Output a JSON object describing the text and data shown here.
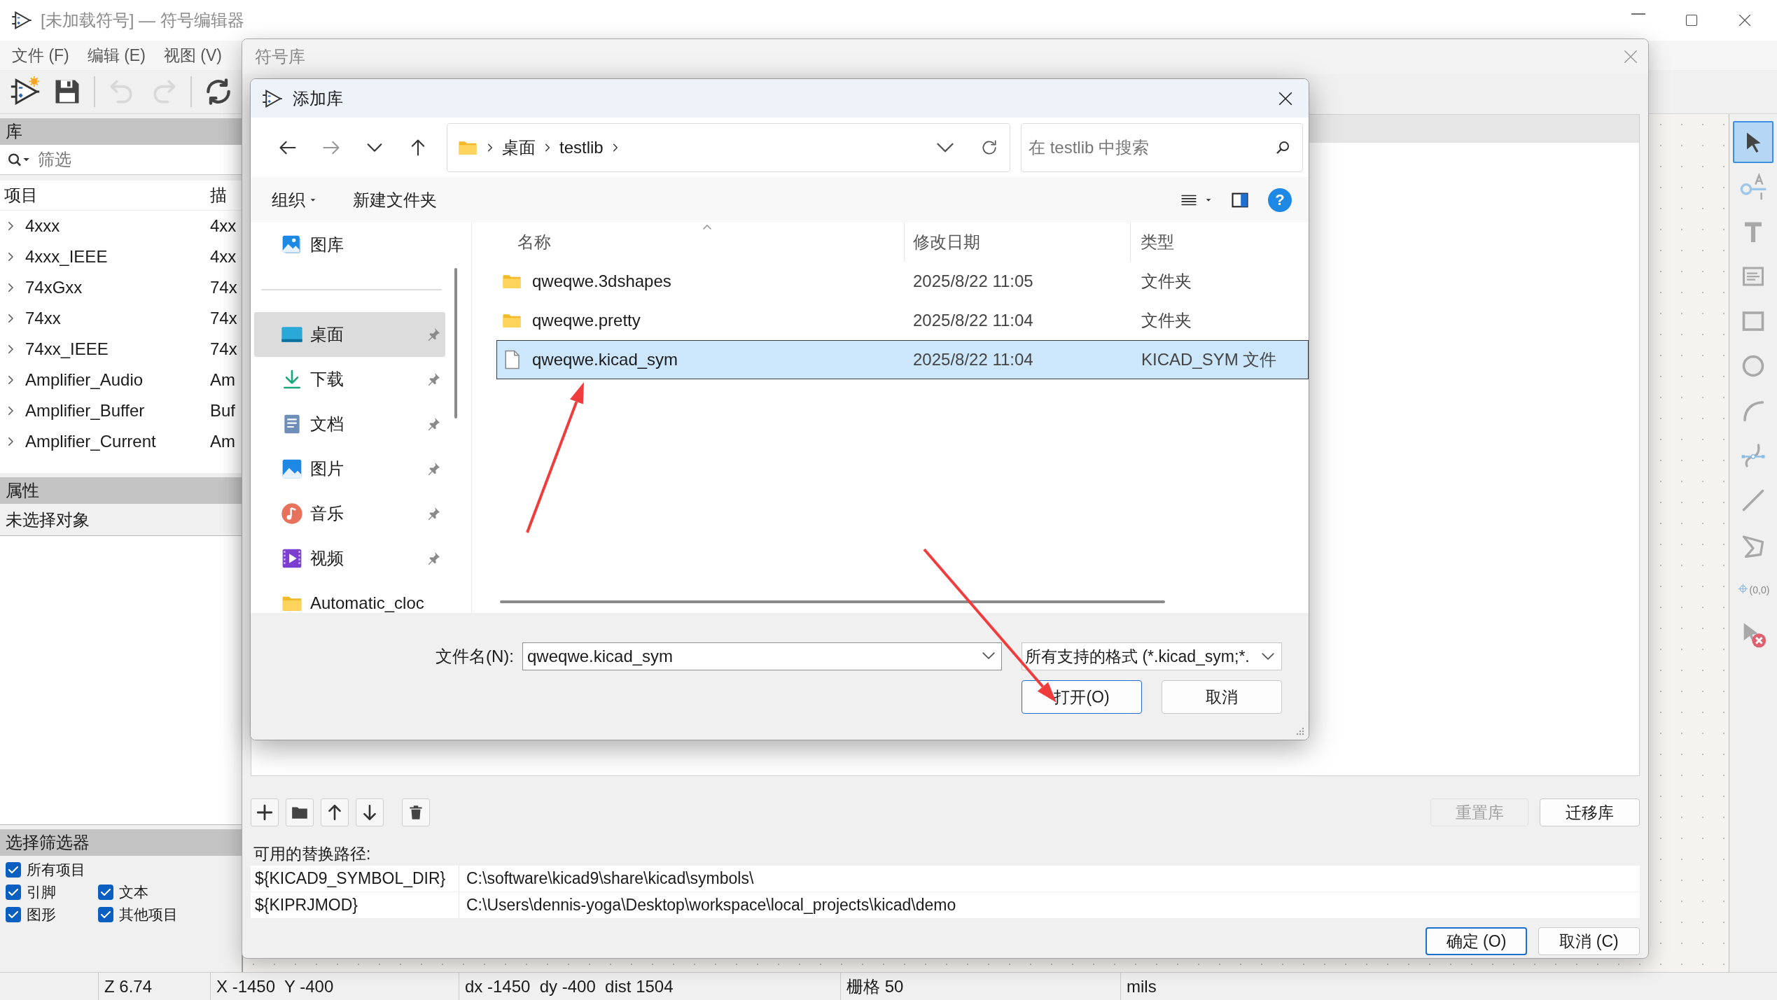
{
  "window": {
    "title": "[未加载符号] — 符号编辑器"
  },
  "menu": [
    "文件 (F)",
    "编辑 (E)",
    "视图 (V)"
  ],
  "toolbar": [
    {
      "kind": "new",
      "disabled": false
    },
    {
      "kind": "save",
      "disabled": false
    },
    {
      "kind": "undo",
      "disabled": true
    },
    {
      "kind": "redo",
      "disabled": true
    },
    {
      "kind": "refresh",
      "disabled": false
    }
  ],
  "library_panel": {
    "title": "库",
    "filter": {
      "placeholder": "筛选"
    },
    "columns": [
      "项目",
      "描"
    ],
    "rows": [
      {
        "name": "4xxx",
        "description": "4xx",
        "expanded": false
      },
      {
        "name": "4xxx_IEEE",
        "description": "4xx",
        "expanded": false
      },
      {
        "name": "74xGxx",
        "description": "74x",
        "expanded": false
      },
      {
        "name": "74xx",
        "description": "74x",
        "expanded": false
      },
      {
        "name": "74xx_IEEE",
        "description": "74x",
        "expanded": false
      },
      {
        "name": "Amplifier_Audio",
        "description": "Am",
        "expanded": false
      },
      {
        "name": "Amplifier_Buffer",
        "description": "Buf",
        "expanded": false
      },
      {
        "name": "Amplifier_Current",
        "description": "Am",
        "expanded": false
      }
    ]
  },
  "properties_panel": {
    "title": "属性",
    "text": "未选择对象"
  },
  "selection_filter": {
    "title": "选择筛选器",
    "items": [
      {
        "label": "所有项目",
        "checked": true
      },
      {
        "label": "引脚",
        "checked": true
      },
      {
        "label": "文本",
        "checked": true
      },
      {
        "label": "图形",
        "checked": true
      },
      {
        "label": "其他项目",
        "checked": true
      }
    ]
  },
  "tools": [
    {
      "kind": "select",
      "selected": true
    },
    {
      "kind": "pin",
      "selected": false
    },
    {
      "kind": "text",
      "selected": false
    },
    {
      "kind": "textbox",
      "selected": false
    },
    {
      "kind": "rectangle",
      "selected": false
    },
    {
      "kind": "circle",
      "selected": false
    },
    {
      "kind": "arc",
      "selected": false
    },
    {
      "kind": "bezier",
      "selected": false
    },
    {
      "kind": "line",
      "selected": false
    },
    {
      "kind": "polygon",
      "selected": false
    },
    {
      "kind": "anchor",
      "selected": false,
      "label": "(0,0)"
    },
    {
      "kind": "delete",
      "selected": false
    }
  ],
  "status_bar": [
    "Z 6.74",
    "X -1450  Y -400",
    "dx -1450  dy -400  dist 1504",
    "栅格 50",
    "mils"
  ],
  "symbol_library_dialog": {
    "title": "符号库",
    "reset_button": {
      "label": "重置库",
      "disabled": true
    },
    "migrate_button": "迁移库",
    "paths_label": "可用的替换路径:",
    "paths": [
      {
        "name": "${KICAD9_SYMBOL_DIR}",
        "value": "C:\\software\\kicad9\\share\\kicad\\symbols\\"
      },
      {
        "name": "${KIPRJMOD}",
        "value": "C:\\Users\\dennis-yoga\\Desktop\\workspace\\local_projects\\kicad\\demo"
      }
    ],
    "ok_button": "确定 (O)",
    "cancel_button": "取消 (C)"
  },
  "add_library_dialog": {
    "title": "添加库",
    "breadcrumb": [
      "桌面",
      "testlib"
    ],
    "search": {
      "placeholder": "在 testlib 中搜索"
    },
    "commands": [
      "组织",
      "新建文件夹"
    ],
    "help_button": "?",
    "nav": [
      {
        "label": "图库",
        "kind": "gallery",
        "pinned": false,
        "selected": false
      },
      {
        "label": "桌面",
        "kind": "desktop",
        "pinned": true,
        "selected": true
      },
      {
        "label": "下载",
        "kind": "download",
        "pinned": true,
        "selected": false
      },
      {
        "label": "文档",
        "kind": "documents",
        "pinned": true,
        "selected": false
      },
      {
        "label": "图片",
        "kind": "pictures",
        "pinned": true,
        "selected": false
      },
      {
        "label": "音乐",
        "kind": "music",
        "pinned": true,
        "selected": false
      },
      {
        "label": "视频",
        "kind": "videos",
        "pinned": true,
        "selected": false
      },
      {
        "label": "Automatic_cloc",
        "kind": "folder",
        "pinned": false,
        "selected": false
      }
    ],
    "columns": [
      "名称",
      "修改日期",
      "类型"
    ],
    "files": [
      {
        "name": "qweqwe.3dshapes",
        "date": "2025/8/22 11:05",
        "type": "文件夹",
        "kind": "folder",
        "selected": false
      },
      {
        "name": "qweqwe.pretty",
        "date": "2025/8/22 11:04",
        "type": "文件夹",
        "kind": "folder",
        "selected": false
      },
      {
        "name": "qweqwe.kicad_sym",
        "date": "2025/8/22 11:04",
        "type": "KICAD_SYM 文件",
        "kind": "file",
        "selected": true
      }
    ],
    "filename": {
      "label": "文件名(N):",
      "value": "qweqwe.kicad_sym"
    },
    "file_type": "所有支持的格式 (*.kicad_sym;*.",
    "open_button": "打开(O)",
    "cancel_button": "取消"
  }
}
